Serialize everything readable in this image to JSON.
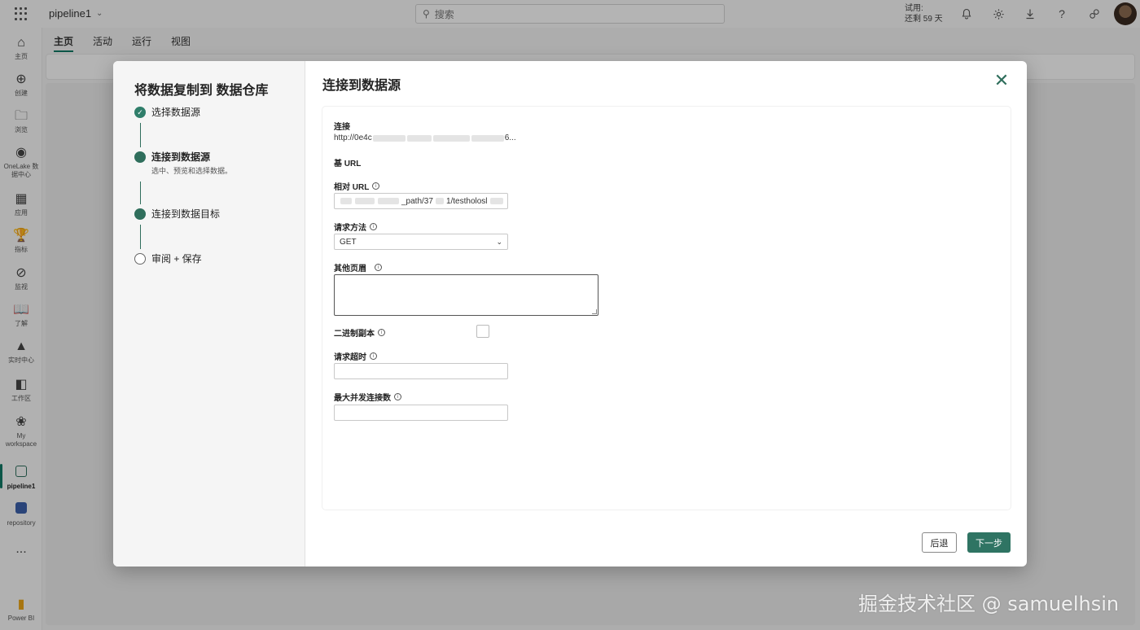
{
  "app": {
    "pipeline_name": "pipeline1",
    "search_placeholder": "搜索",
    "trial_line1": "试用:",
    "trial_line2": "还剩 59 天"
  },
  "rail": {
    "items": [
      {
        "icon": "home-icon",
        "label": "主页"
      },
      {
        "icon": "create-icon",
        "label": "创建"
      },
      {
        "icon": "browse-icon",
        "label": "浏览"
      },
      {
        "icon": "onelake-icon",
        "label": "OneLake 数据中心"
      },
      {
        "icon": "apps-icon",
        "label": "应用"
      },
      {
        "icon": "metrics-icon",
        "label": "指标"
      },
      {
        "icon": "monitor-icon",
        "label": "监视"
      },
      {
        "icon": "learn-icon",
        "label": "了解"
      },
      {
        "icon": "realtime-icon",
        "label": "实时中心"
      },
      {
        "icon": "workspaces-icon",
        "label": "工作区"
      },
      {
        "icon": "my-workspace-icon",
        "label": "My workspace"
      },
      {
        "icon": "pipeline-icon",
        "label": "pipeline1"
      },
      {
        "icon": "repository-icon",
        "label": "repository"
      },
      {
        "icon": "more-icon",
        "label": "..."
      },
      {
        "icon": "powerbi-icon",
        "label": "Power BI"
      }
    ]
  },
  "tabs": [
    "主页",
    "活动",
    "运行",
    "视图"
  ],
  "dialog": {
    "wizard_title": "将数据复制到 数据仓库",
    "steps": [
      {
        "label": "选择数据源",
        "sub": ""
      },
      {
        "label": "连接到数据源",
        "sub": "选中、预览和选择数据。"
      },
      {
        "label": "连接到数据目标",
        "sub": ""
      },
      {
        "label": "审阅 + 保存",
        "sub": ""
      }
    ],
    "main_title": "连接到数据源",
    "form": {
      "connection_label": "连接",
      "connection_value_prefix": "http://0e4c",
      "connection_value_suffix": "6...",
      "base_url_label": "基 URL",
      "relative_url_label": "相对 URL",
      "relative_url_value_mid": "_path/37",
      "relative_url_value_tail": "1/testholosl",
      "method_label": "请求方法",
      "method_value": "GET",
      "headers_label": "其他页眉",
      "binary_label": "二进制副本",
      "timeout_label": "请求超时",
      "max_conn_label": "最大并发连接数"
    },
    "back_label": "后退",
    "next_label": "下一步"
  },
  "watermark": "掘金技术社区 @ samuelhsin"
}
